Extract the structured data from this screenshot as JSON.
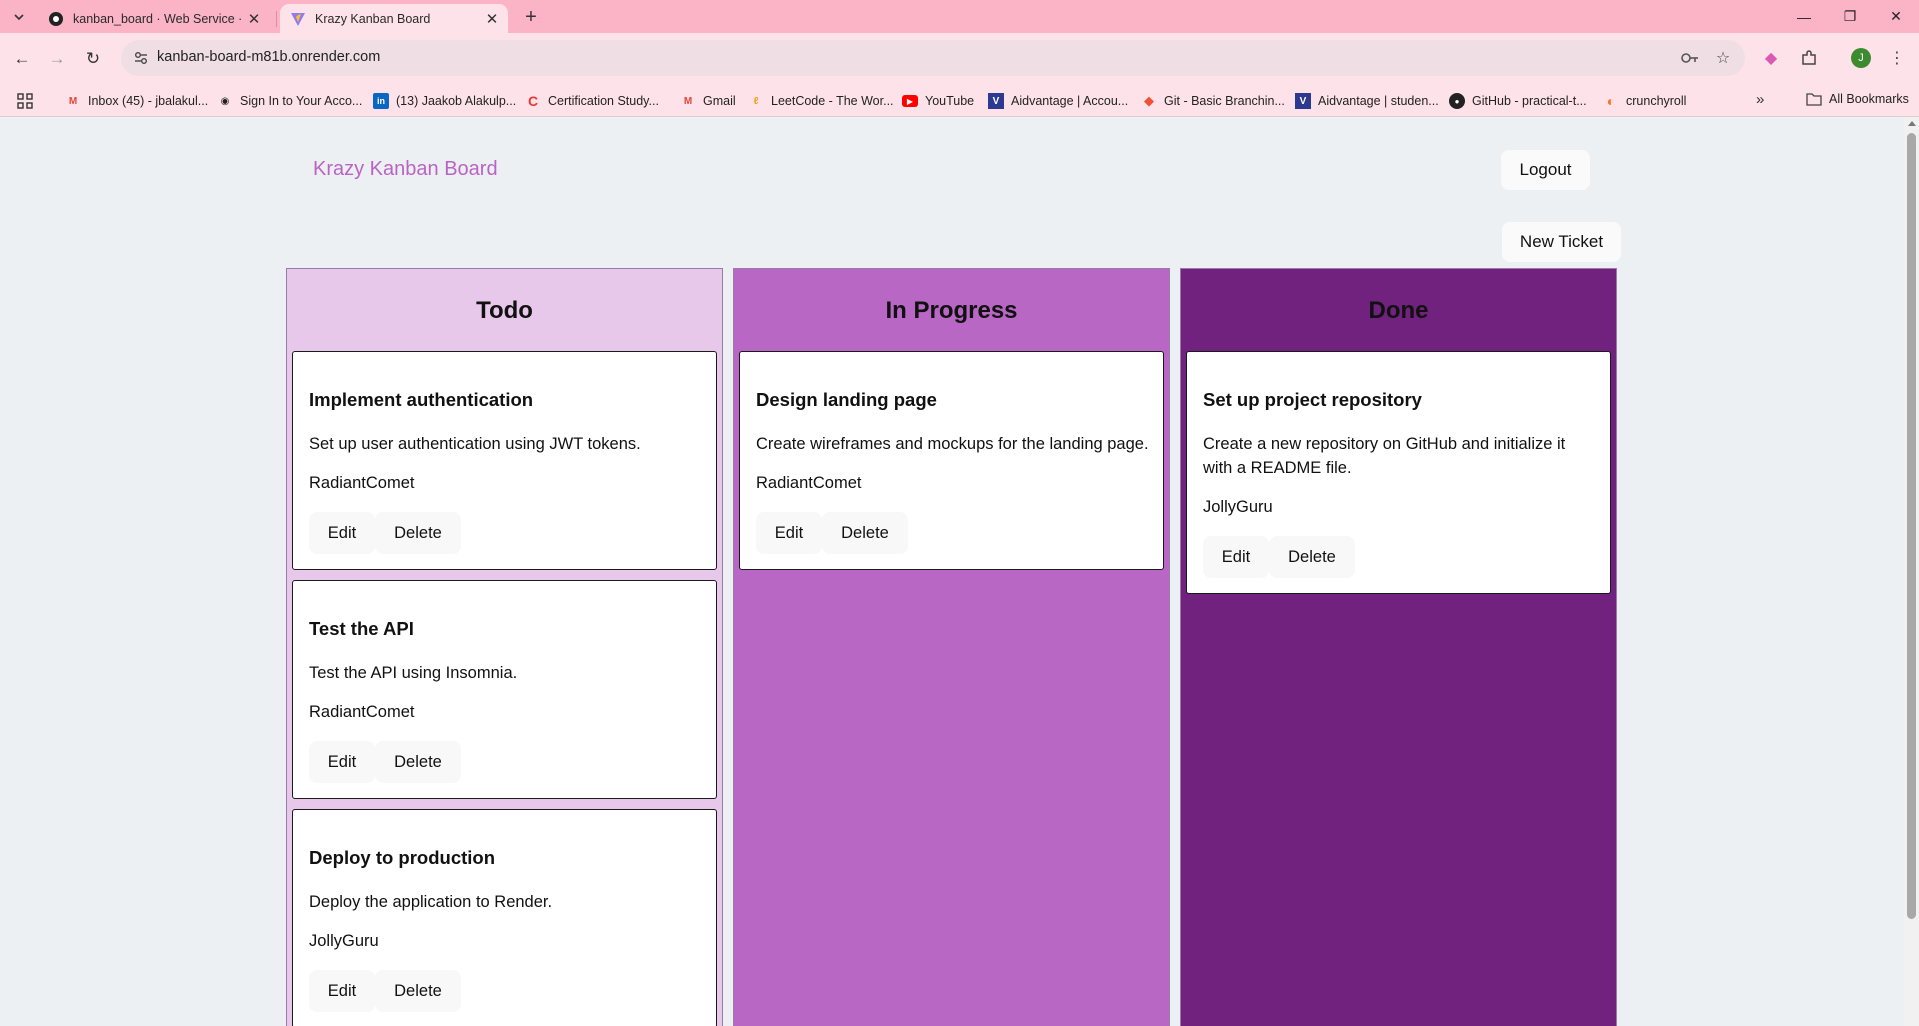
{
  "browser": {
    "tabs": [
      {
        "title": "kanban_board · Web Service ·",
        "active": false
      },
      {
        "title": "Krazy Kanban Board",
        "active": true
      }
    ],
    "url": "kanban-board-m81b.onrender.com",
    "profile_initial": "J",
    "bookmarks": [
      {
        "label": "Inbox (45) - jbalakul...",
        "icon": "gmail-icon"
      },
      {
        "label": "Sign In to Your Acco...",
        "icon": "globe-icon"
      },
      {
        "label": "(13) Jaakob Alakulp...",
        "icon": "linkedin-icon"
      },
      {
        "label": "Certification Study...",
        "icon": "coursera-icon"
      },
      {
        "label": "Gmail",
        "icon": "gmail-icon"
      },
      {
        "label": "LeetCode - The Wor...",
        "icon": "leetcode-icon"
      },
      {
        "label": "YouTube",
        "icon": "youtube-icon"
      },
      {
        "label": "Aidvantage | Accou...",
        "icon": "aidvantage-icon"
      },
      {
        "label": "Git - Basic Branchin...",
        "icon": "git-icon"
      },
      {
        "label": "Aidvantage | studen...",
        "icon": "aidvantage-icon"
      },
      {
        "label": "GitHub - practical-t...",
        "icon": "github-icon"
      },
      {
        "label": "crunchyroll",
        "icon": "crunchyroll-icon"
      }
    ],
    "all_bookmarks_label": "All Bookmarks"
  },
  "app": {
    "brand": "Krazy Kanban Board",
    "logout_label": "Logout",
    "new_ticket_label": "New Ticket",
    "edit_label": "Edit",
    "delete_label": "Delete",
    "columns": [
      {
        "title": "Todo",
        "color": "#e8c8ea",
        "cards": [
          {
            "title": "Implement authentication",
            "description": "Set up user authentication using JWT tokens.",
            "assignee": "RadiantComet"
          },
          {
            "title": "Test the API",
            "description": "Test the API using Insomnia.",
            "assignee": "RadiantComet"
          },
          {
            "title": "Deploy to production",
            "description": "Deploy the application to Render.",
            "assignee": "JollyGuru"
          }
        ]
      },
      {
        "title": "In Progress",
        "color": "#b967c4",
        "cards": [
          {
            "title": "Design landing page",
            "description": "Create wireframes and mockups for the landing page.",
            "assignee": "RadiantComet"
          }
        ]
      },
      {
        "title": "Done",
        "color": "#71227e",
        "cards": [
          {
            "title": "Set up project repository",
            "description": "Create a new repository on GitHub and initialize it with a README file.",
            "assignee": "JollyGuru"
          }
        ]
      }
    ]
  },
  "colors": {
    "tabstrip": "#fbb3c6",
    "toolbar": "#fde2ea",
    "brand": "#b964c4",
    "page_bg": "#edf0f2"
  }
}
